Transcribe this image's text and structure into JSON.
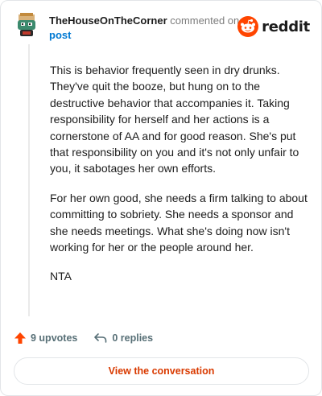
{
  "comment": {
    "author": "TheHouseOnTheCorner",
    "action_text": "commented on",
    "post_link": "post",
    "paragraphs": [
      "This is behavior frequently seen in dry drunks. They've quit the booze, but hung on to the destructive behavior that accompanies it. Taking responsibility for herself and her actions is a cornerstone of AA and for good reason. She's put that responsibility on you and it's not only unfair to you, it sabotages her own efforts.",
      "For her own good, she needs a firm talking to about committing to sobriety. She needs a sponsor and she needs meetings. What she's doing now isn't working for her or the people around her.",
      "NTA"
    ]
  },
  "brand": {
    "wordmark": "reddit",
    "color": "#ff4500"
  },
  "actions": {
    "upvotes": "9 upvotes",
    "replies": "0 replies"
  },
  "cta": {
    "label": "View the conversation"
  },
  "colors": {
    "upvote": "#ff4500",
    "cta_text": "#d93a00",
    "link": "#0079d3"
  }
}
